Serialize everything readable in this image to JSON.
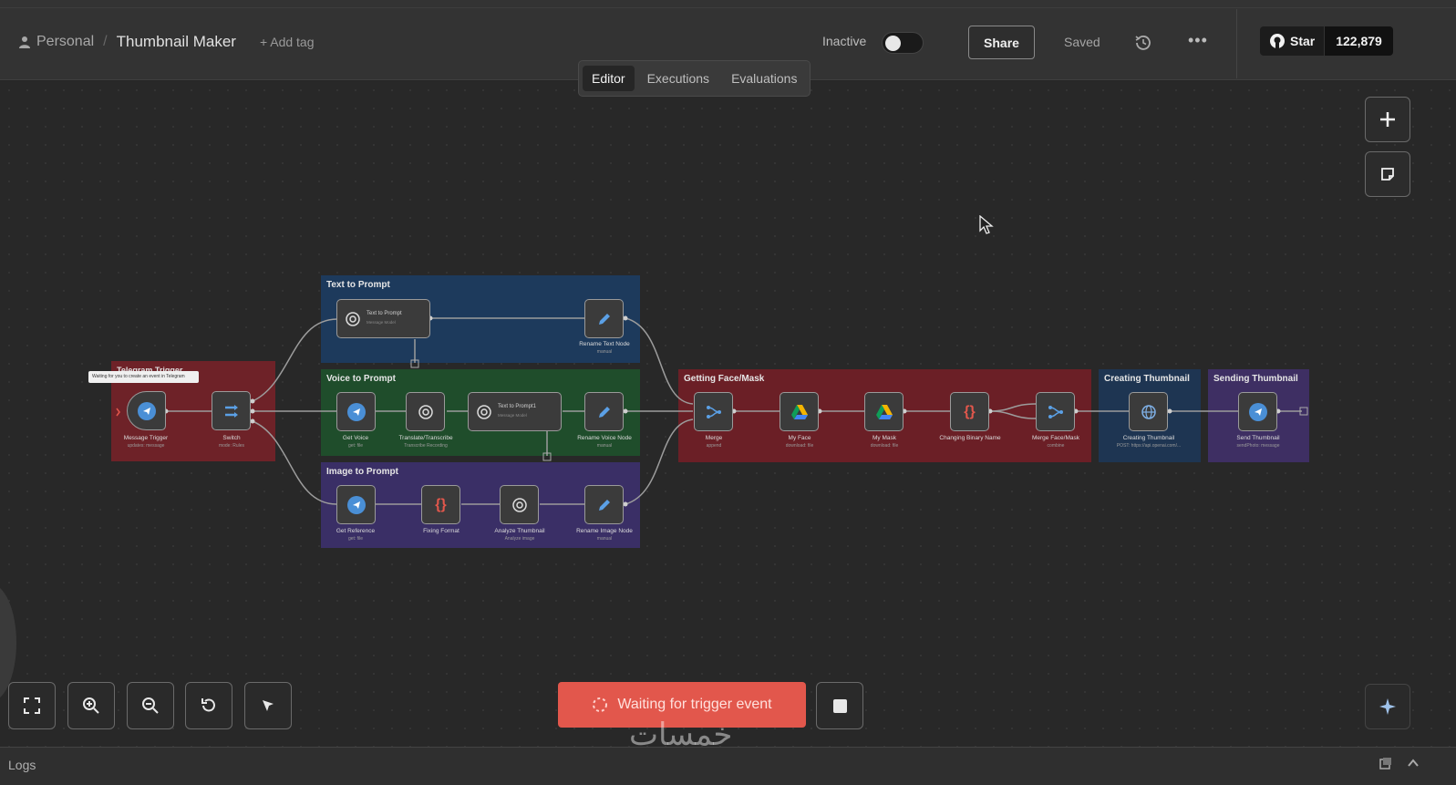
{
  "header": {
    "project": "Personal",
    "workflow_name": "Thumbnail Maker",
    "add_tag": "+ Add tag",
    "status_label": "Inactive",
    "share_label": "Share",
    "saved_label": "Saved",
    "more_label": "•••",
    "github_star": "Star",
    "github_count": "122,879"
  },
  "tabs": [
    {
      "label": "Editor",
      "active": true
    },
    {
      "label": "Executions",
      "active": false
    },
    {
      "label": "Evaluations",
      "active": false
    }
  ],
  "groups": {
    "telegram": {
      "title": "Telegram Trigger",
      "color": "#6e2228"
    },
    "text": {
      "title": "Text to Prompt",
      "color": "#1d3a5c"
    },
    "voice": {
      "title": "Voice to Prompt",
      "color": "#1f4d2b"
    },
    "image": {
      "title": "Image to Prompt",
      "color": "#3a2f66"
    },
    "face": {
      "title": "Getting Face/Mask",
      "color": "#6b1f26"
    },
    "creating": {
      "title": "Creating Thumbnail",
      "color": "#1e3552"
    },
    "sending": {
      "title": "Sending Thumbnail",
      "color": "#3e2f63"
    }
  },
  "tooltip": "Waiting for you to create an event in Telegram",
  "nodes": {
    "message_trigger": {
      "label": "Message Trigger",
      "sub": "updates: message"
    },
    "switch": {
      "label": "Switch",
      "sub": "mode: Rules"
    },
    "text_to_prompt": {
      "title": "Text to Prompt",
      "sub": "Message Model"
    },
    "rename_text": {
      "label": "Rename Text Node",
      "sub": "manual"
    },
    "get_voice": {
      "label": "Get Voice",
      "sub": "get: file"
    },
    "translate": {
      "label": "Translate/Transcribe",
      "sub": "Transcribe Recording"
    },
    "text_to_prompt1": {
      "title": "Text to Prompt1",
      "sub": "Message Model"
    },
    "rename_voice": {
      "label": "Rename Voice Node",
      "sub": "manual"
    },
    "get_reference": {
      "label": "Get Reference",
      "sub": "get: file"
    },
    "fixing_format": {
      "label": "Fixing Format",
      "sub": ""
    },
    "analyze_thumbnail": {
      "label": "Analyze Thumbnail",
      "sub": "Analyze image"
    },
    "rename_image": {
      "label": "Rename Image Node",
      "sub": "manual"
    },
    "merge": {
      "label": "Merge",
      "sub": "append"
    },
    "my_face": {
      "label": "My Face",
      "sub": "download: file"
    },
    "my_mask": {
      "label": "My Mask",
      "sub": "download: file"
    },
    "changing_binary": {
      "label": "Changing Binary Name",
      "sub": ""
    },
    "merge_face_mask": {
      "label": "Merge Face/Mask",
      "sub": "combine"
    },
    "creating_thumbnail": {
      "label": "Creating Thumbnail",
      "sub": "POST: https://api.openai.com/..."
    },
    "send_thumbnail": {
      "label": "Send Thumbnail",
      "sub": "sendPhoto: message"
    }
  },
  "bottom": {
    "waiting_label": "Waiting for trigger event",
    "watermark": "خمسات"
  },
  "logs": {
    "label": "Logs"
  }
}
